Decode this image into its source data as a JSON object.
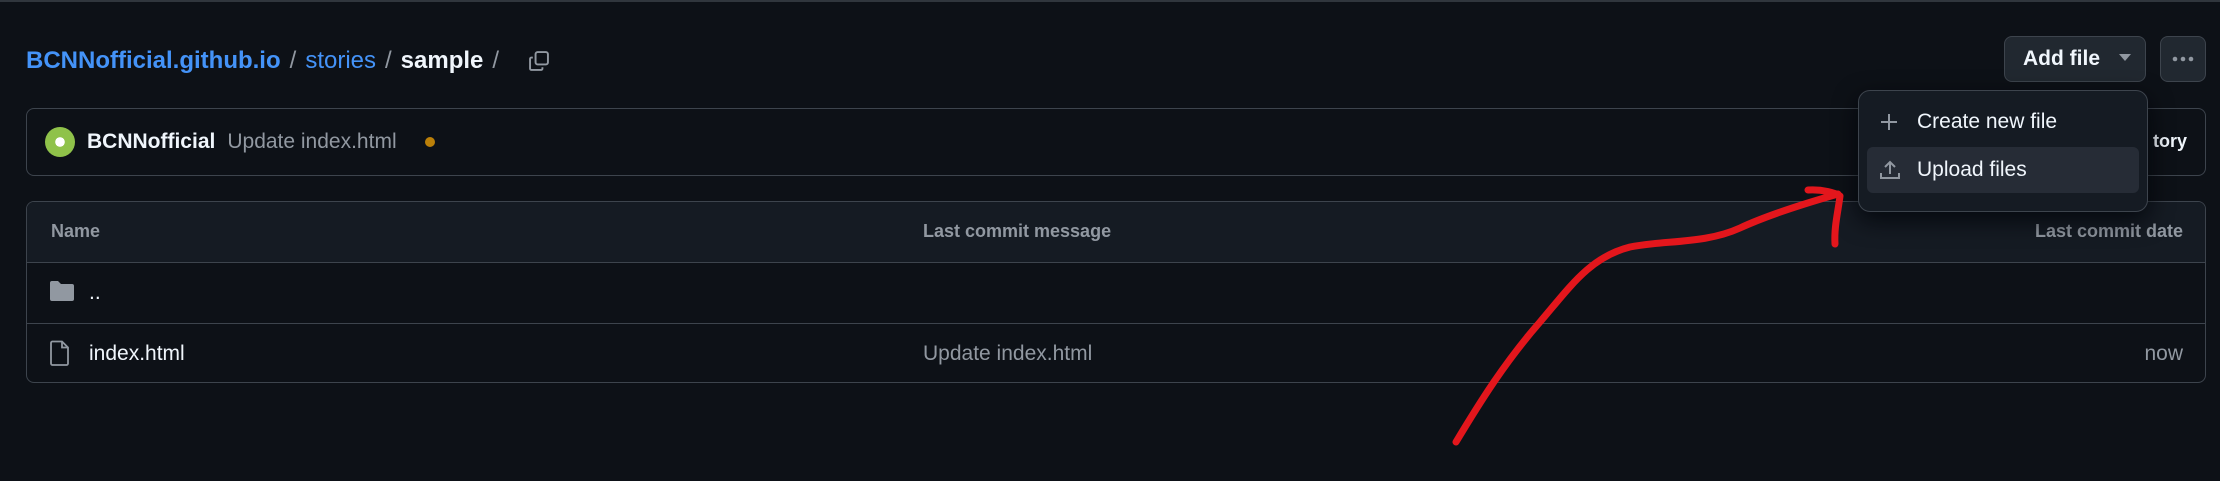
{
  "breadcrumb": {
    "repo": "BCNNofficial.github.io",
    "folder": "stories",
    "current": "sample",
    "separator": "/"
  },
  "toolbar": {
    "add_file_label": "Add file"
  },
  "commit": {
    "author": "BCNNofficial",
    "message": "Update index.html",
    "history_label": "tory"
  },
  "table": {
    "headers": [
      "Name",
      "Last commit message",
      "Last commit date"
    ],
    "rows": [
      {
        "name": "..",
        "type": "folder",
        "message": "",
        "date": ""
      },
      {
        "name": "index.html",
        "type": "file",
        "message": "Update index.html",
        "date": "now"
      }
    ]
  },
  "menu": {
    "items": [
      {
        "label": "Create new file",
        "icon": "plus-icon"
      },
      {
        "label": "Upload files",
        "icon": "upload-icon"
      }
    ]
  },
  "colors": {
    "background": "#0d1117",
    "link": "#4493f8",
    "annotation": "#e3161c",
    "status_dot": "#bb8009"
  }
}
